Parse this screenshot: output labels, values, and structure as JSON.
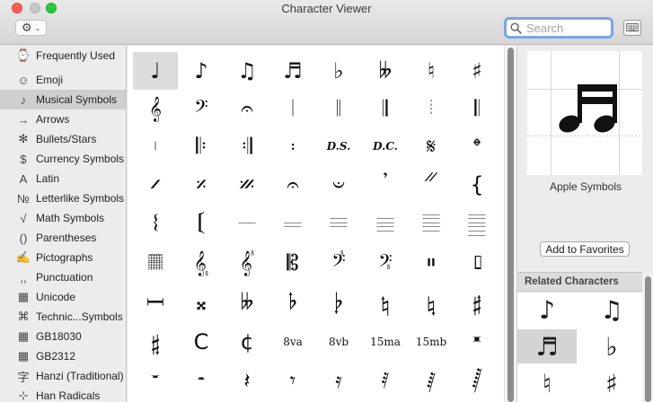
{
  "window": {
    "title": "Character Viewer"
  },
  "toolbar": {
    "gear_icon": "gear-icon",
    "search_placeholder": "Search",
    "search_value": ""
  },
  "sidebar": {
    "items": [
      {
        "label": "Frequently Used",
        "icon": "⌚"
      },
      {
        "label": "Emoji",
        "icon": "☺"
      },
      {
        "label": "Musical Symbols",
        "icon": "♪",
        "selected": true
      },
      {
        "label": "Arrows",
        "icon": "→"
      },
      {
        "label": "Bullets/Stars",
        "icon": "✻"
      },
      {
        "label": "Currency Symbols",
        "icon": "$"
      },
      {
        "label": "Latin",
        "icon": "A"
      },
      {
        "label": "Letterlike Symbols",
        "icon": "№"
      },
      {
        "label": "Math Symbols",
        "icon": "√"
      },
      {
        "label": "Parentheses",
        "icon": "()"
      },
      {
        "label": "Pictographs",
        "icon": "✍"
      },
      {
        "label": "Punctuation",
        "icon": ",,"
      },
      {
        "label": "Unicode",
        "icon": "▦"
      },
      {
        "label": "Technic...Symbols",
        "icon": "⌘"
      },
      {
        "label": "GB18030",
        "icon": "▦"
      },
      {
        "label": "GB2312",
        "icon": "▦"
      },
      {
        "label": "Hanzi (Traditional)",
        "icon": "字"
      },
      {
        "label": "Han Radicals",
        "icon": "⊹"
      }
    ]
  },
  "grid": {
    "rows": [
      [
        "♩",
        "♪",
        "♫",
        "♬",
        "♭",
        "𝄫",
        "♮",
        "♯"
      ],
      [
        "𝄞",
        "𝄢",
        "𝄐",
        "𝄀",
        "𝄁",
        "𝄂",
        "𝄄",
        "𝄃"
      ],
      [
        "𝄅",
        "𝄆",
        "𝄇",
        "𝄈",
        "D.S.",
        "D.C.",
        "𝄋",
        "𝄌"
      ],
      [
        "𝄍",
        "𝄎",
        "𝄏",
        "𝄐",
        "𝄑",
        "𝄒",
        "𝄓",
        "{"
      ],
      [
        "𝄔",
        "𝄕",
        "𝄖",
        "𝄗",
        "𝄘",
        "𝄙",
        "𝄚",
        "𝄛"
      ],
      [
        "𝄜",
        "𝄠",
        "𝄟",
        "𝄡",
        "𝄣",
        "𝄤",
        "𝄥",
        "𝄦"
      ],
      [
        "𝄩",
        "𝄪",
        "𝄫",
        "𝄬",
        "𝄭",
        "𝄮",
        "𝄯",
        "𝄰"
      ],
      [
        "𝄱",
        "C",
        "¢",
        "8va",
        "8vb",
        "15ma",
        "15mb",
        "𝄺"
      ],
      [
        "𝄻",
        "𝄼",
        "𝄽",
        "𝄾",
        "𝄿",
        "𝅀",
        "𝅁",
        "𝅂"
      ]
    ]
  },
  "preview": {
    "glyph": "♬",
    "font_name": "Apple Symbols",
    "add_favorites_label": "Add to Favorites"
  },
  "related": {
    "title": "Related Characters",
    "items": [
      "♪",
      "♫",
      "♬",
      "♭",
      "♮",
      "♯"
    ]
  }
}
